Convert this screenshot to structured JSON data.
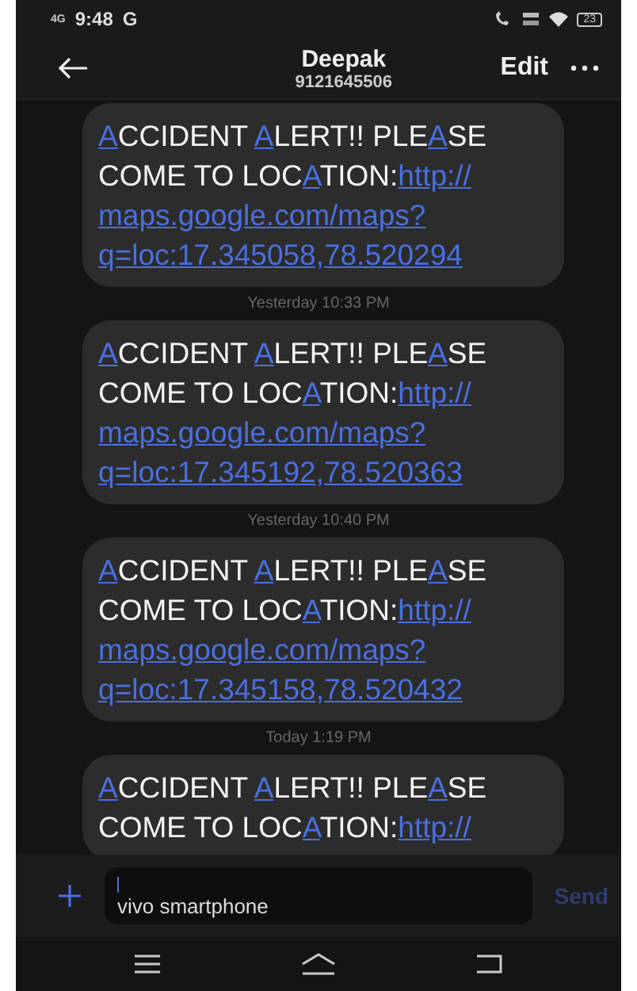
{
  "status_bar": {
    "network": "4G",
    "time": "9:48",
    "carrier": "G",
    "battery": "23"
  },
  "header": {
    "name": "Deepak",
    "number": "9121645506",
    "edit": "Edit"
  },
  "thread": [
    {
      "kind": "message",
      "parts": [
        {
          "kind": "accent",
          "text": "A"
        },
        {
          "kind": "plain",
          "text": "CCIDENT "
        },
        {
          "kind": "accent",
          "text": "A"
        },
        {
          "kind": "plain",
          "text": "LERT!! PLE"
        },
        {
          "kind": "accent",
          "text": "A"
        },
        {
          "kind": "plain",
          "text": "SE COME TO LOC"
        },
        {
          "kind": "accent",
          "text": "A"
        },
        {
          "kind": "plain",
          "text": "TION:"
        },
        {
          "kind": "link",
          "text": "http://"
        },
        {
          "kind": "link",
          "text": "maps.google.com/maps?"
        },
        {
          "kind": "link",
          "text": "q=loc:17.345058,78.520294"
        }
      ]
    },
    {
      "kind": "timestamp",
      "text": "Yesterday 10:33 PM"
    },
    {
      "kind": "message",
      "parts": [
        {
          "kind": "accent",
          "text": "A"
        },
        {
          "kind": "plain",
          "text": "CCIDENT "
        },
        {
          "kind": "accent",
          "text": "A"
        },
        {
          "kind": "plain",
          "text": "LERT!! PLE"
        },
        {
          "kind": "accent",
          "text": "A"
        },
        {
          "kind": "plain",
          "text": "SE COME TO LOC"
        },
        {
          "kind": "accent",
          "text": "A"
        },
        {
          "kind": "plain",
          "text": "TION:"
        },
        {
          "kind": "link",
          "text": "http://"
        },
        {
          "kind": "link",
          "text": "maps.google.com/maps?"
        },
        {
          "kind": "link",
          "text": "q=loc:17.345192,78.520363"
        }
      ]
    },
    {
      "kind": "timestamp",
      "text": "Yesterday 10:40 PM"
    },
    {
      "kind": "message",
      "parts": [
        {
          "kind": "accent",
          "text": "A"
        },
        {
          "kind": "plain",
          "text": "CCIDENT "
        },
        {
          "kind": "accent",
          "text": "A"
        },
        {
          "kind": "plain",
          "text": "LERT!! PLE"
        },
        {
          "kind": "accent",
          "text": "A"
        },
        {
          "kind": "plain",
          "text": "SE COME TO LOC"
        },
        {
          "kind": "accent",
          "text": "A"
        },
        {
          "kind": "plain",
          "text": "TION:"
        },
        {
          "kind": "link",
          "text": "http://"
        },
        {
          "kind": "link",
          "text": "maps.google.com/maps?"
        },
        {
          "kind": "link",
          "text": "q=loc:17.345158,78.520432"
        }
      ]
    },
    {
      "kind": "timestamp",
      "text": "Today 1:19 PM"
    },
    {
      "kind": "message",
      "parts": [
        {
          "kind": "accent",
          "text": "A"
        },
        {
          "kind": "plain",
          "text": "CCIDENT "
        },
        {
          "kind": "accent",
          "text": "A"
        },
        {
          "kind": "plain",
          "text": "LERT!! PLE"
        },
        {
          "kind": "accent",
          "text": "A"
        },
        {
          "kind": "plain",
          "text": "SE COME TO LOC"
        },
        {
          "kind": "accent",
          "text": "A"
        },
        {
          "kind": "plain",
          "text": "TION:"
        },
        {
          "kind": "link",
          "text": "http://"
        }
      ]
    }
  ],
  "composer": {
    "placeholder": "vivo smartphone",
    "send": {
      "label": "Send",
      "disabled": true
    }
  }
}
